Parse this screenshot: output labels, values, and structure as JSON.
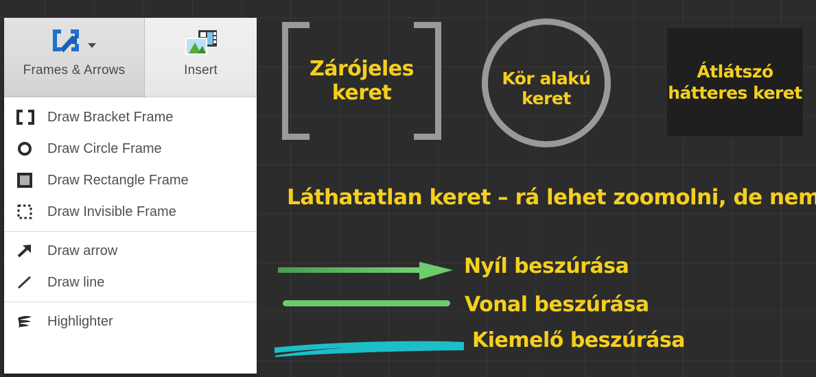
{
  "toolbar": {
    "tabs": [
      {
        "label": "Frames & Arrows",
        "icon": "frames-and-arrows-icon",
        "active": true
      },
      {
        "label": "Insert",
        "icon": "insert-image-icon",
        "active": false
      }
    ]
  },
  "menu": {
    "groups": [
      {
        "items": [
          {
            "label": "Draw Bracket Frame",
            "icon": "bracket-frame-icon"
          },
          {
            "label": "Draw Circle Frame",
            "icon": "circle-frame-icon"
          },
          {
            "label": "Draw Rectangle Frame",
            "icon": "rectangle-frame-icon"
          },
          {
            "label": "Draw Invisible Frame",
            "icon": "invisible-frame-icon"
          }
        ]
      },
      {
        "items": [
          {
            "label": "Draw arrow",
            "icon": "arrow-icon"
          },
          {
            "label": "Draw line",
            "icon": "line-icon"
          }
        ]
      },
      {
        "items": [
          {
            "label": "Highlighter",
            "icon": "highlighter-icon"
          }
        ]
      }
    ]
  },
  "canvas": {
    "bracket_frame_label": "Zárójeles keret",
    "circle_frame_label": "Kör alakú keret",
    "transparent_frame_label_line1": "Átlátszó",
    "transparent_frame_label_line2": "hátteres keret",
    "invisible_frame_label": "Láthatatlan keret – rá lehet zoomolni, de nem látszik",
    "arrow_label": "Nyíl beszúrása",
    "line_label": "Vonal beszúrása",
    "highlighter_label": "Kiemelő beszúrása"
  },
  "colors": {
    "annotation_text": "#f5cf1e",
    "frame_stroke": "#9a9a9a",
    "arrow_green": "#6ec96e",
    "highlighter_cyan": "#1cbfc8",
    "canvas_background": "#2c2c2c",
    "transparent_frame_fill": "#1f1f1f",
    "toolbar_icon_blue": "#1f72d0"
  }
}
